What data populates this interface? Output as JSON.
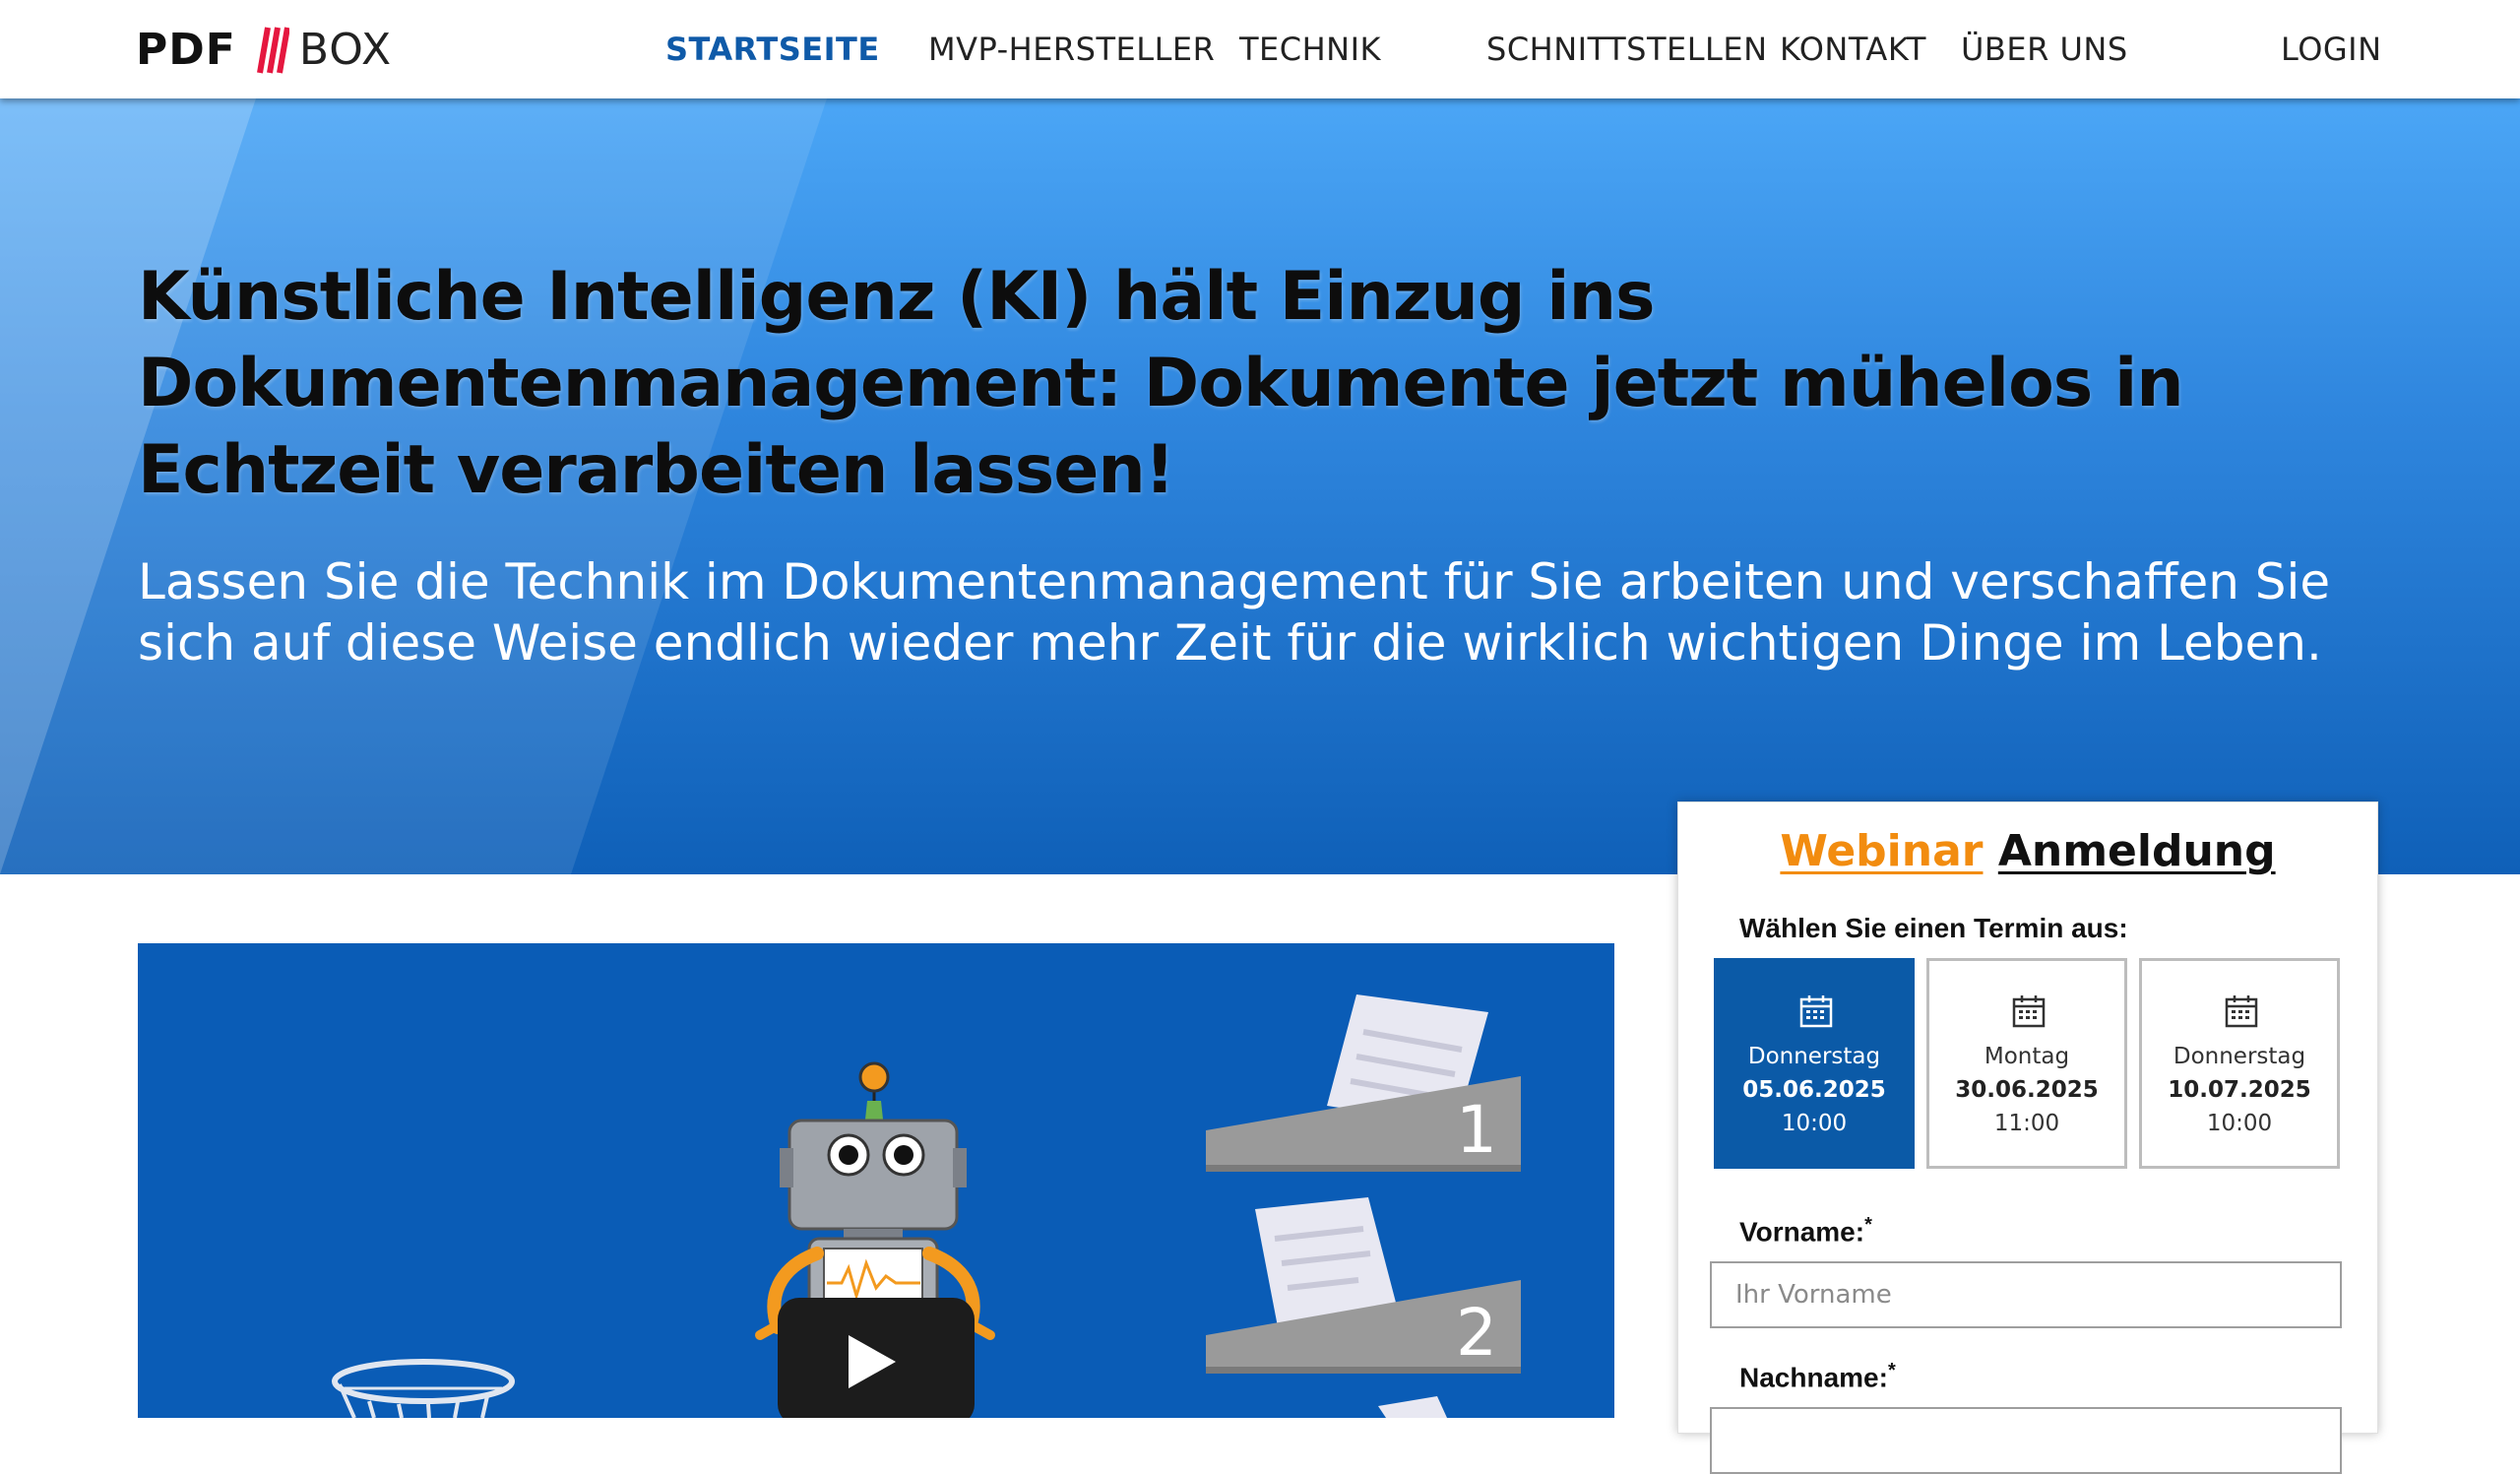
{
  "brand": {
    "logo_left": "PDF",
    "logo_right": "BOX",
    "slash_color": "#e5173f"
  },
  "nav": {
    "items": [
      {
        "label": "STARTSEITE",
        "active": true
      },
      {
        "label": "MVP-HERSTELLER",
        "active": false
      },
      {
        "label": "TECHNIK",
        "active": false
      },
      {
        "label": "SCHNITTSTELLEN",
        "active": false
      },
      {
        "label": "KONTAKT",
        "active": false
      },
      {
        "label": "ÜBER UNS",
        "active": false
      },
      {
        "label": "LOGIN",
        "active": false
      }
    ]
  },
  "hero": {
    "title": "Künstliche Intelligenz (KI) hält Einzug ins Dokumentenmanagement: Dokumente jetzt mühelos in Echtzeit verarbeiten lassen!",
    "subtitle": "Lassen Sie die Technik im Dokumentenmanagement für Sie arbeiten und verschaffen Sie sich auf diese Weise endlich wieder mehr Zeit für die wirklich wichtigen Dinge im Leben."
  },
  "video": {
    "tray_labels": [
      "1",
      "2"
    ],
    "play_icon": "play-icon"
  },
  "webinar": {
    "title_part1": "Webinar",
    "title_part2": "Anmeldung",
    "choose_label": "Wählen Sie einen Termin aus:",
    "dates": [
      {
        "weekday": "Donnerstag",
        "date": "05.06.2025",
        "time": "10:00",
        "selected": true
      },
      {
        "weekday": "Montag",
        "date": "30.06.2025",
        "time": "11:00",
        "selected": false
      },
      {
        "weekday": "Donnerstag",
        "date": "10.07.2025",
        "time": "10:00",
        "selected": false
      }
    ],
    "firstname_label": "Vorname:",
    "firstname_placeholder": "Ihr Vorname",
    "lastname_label": "Nachname:",
    "required_mark": "*"
  },
  "colors": {
    "accent_blue": "#0b5aa7",
    "nav_active": "#0f5aa8",
    "webinar_orange": "#f28c0f",
    "hero_top": "#4ba6f6",
    "hero_bottom": "#0f60b8"
  }
}
